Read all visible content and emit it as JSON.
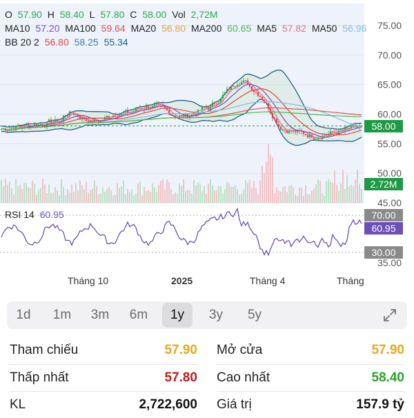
{
  "colors": {
    "ma10": "#7b4fb5",
    "ma100": "#e05252",
    "ma20": "#e8a33c",
    "ma200": "#4fb84f",
    "ma5": "#e66b94",
    "ma50": "#7ec0e0",
    "bb": "#3a7fa8",
    "bb_lower": "#1f5f8a",
    "bb_mid": "#e04545",
    "up": "#2ea84a",
    "down": "#e0454e",
    "price_tag": "#1e9a44",
    "rsi": "#6c50b8",
    "grey_tag": "#8a8a8a",
    "ref_yellow": "#e8a81f",
    "low_red": "#c21b1b",
    "high_green": "#27a52a"
  },
  "legend": {
    "o_label": "O",
    "o_val": "57.90",
    "h_label": "H",
    "h_val": "58.40",
    "l_label": "L",
    "l_val": "57.80",
    "c_label": "C",
    "c_val": "58.00",
    "vol_label": "Vol",
    "vol_val": "2,72M",
    "ma10_label": "MA10",
    "ma10_val": "57.20",
    "ma100_label": "MA100",
    "ma100_val": "59.64",
    "ma20_label": "MA20",
    "ma20_val": "56.80",
    "ma200_label": "MA200",
    "ma200_val": "60.65",
    "ma5_label": "MA5",
    "ma5_val": "57.82",
    "ma50_label": "MA50",
    "ma50_val": "56.96",
    "bb_label": "BB 20 2",
    "bb_upper": "56.80",
    "bb_mid": "58.25",
    "bb_lower": "55.34",
    "rsi_label": "RSI 14",
    "rsi_val": "60.95"
  },
  "price_axis": [
    "75.00",
    "70.00",
    "65.00",
    "60.00",
    "55.00",
    "50.00",
    "45.00"
  ],
  "rsi_axis": [
    "35.00"
  ],
  "tags": {
    "price": "58.00",
    "volume": "2.72M",
    "rsi70": "70.00",
    "rsi": "60.95",
    "rsi30": "30.00"
  },
  "time_axis": [
    "Tháng 10",
    "2025",
    "Tháng 4",
    "Tháng"
  ],
  "ranges": [
    "1d",
    "1m",
    "3m",
    "6m",
    "1y",
    "3y",
    "5y"
  ],
  "active_range": "1y",
  "stats": {
    "ref_label": "Tham chiếu",
    "ref_val": "57.90",
    "open_label": "Mở cửa",
    "open_val": "57.90",
    "low_label": "Thấp nhất",
    "low_val": "57.80",
    "high_label": "Cao nhất",
    "high_val": "58.40",
    "vol_label": "KL",
    "vol_val": "2,722,600",
    "value_label": "Giá trị",
    "value_val": "157.9 tỷ"
  }
}
